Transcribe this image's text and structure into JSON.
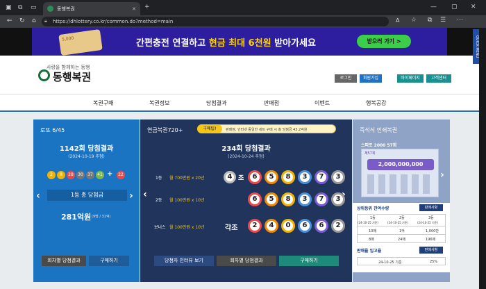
{
  "browser": {
    "tab_title": "동행복권",
    "url": "https://dhlottery.co.kr/common.do?method=main"
  },
  "banner": {
    "text_1": "간편충전 연결하고 ",
    "text_highlight": "현금 최대 6천원",
    "text_2": " 받아가세요",
    "button": "받으러 가기 >",
    "coupon_text": "5,000"
  },
  "quick_menu": "QUICK MENU",
  "header": {
    "logo_tagline": "사랑을 함께하는 동행",
    "logo_text": "동행복권",
    "buttons": [
      "로그인",
      "회원가입",
      "마이페이지",
      "고객센터"
    ],
    "nav": [
      "복권구매",
      "복권정보",
      "당첨결과",
      "판매점",
      "이벤트",
      "행복공감"
    ]
  },
  "lotto": {
    "label": "로또 6/45",
    "round_title": "1142회 당첨결과",
    "date": "(2024-10-19 추첨)",
    "balls": [
      "2",
      "8",
      "28",
      "30",
      "37",
      "41"
    ],
    "plus": "+",
    "bonus": "22",
    "first_prize_label": "1등 총 당첨금",
    "first_prize_amount": "281억원",
    "first_prize_detail": "(9명 / 31억)",
    "btn_results": "회차별 당첨결과",
    "btn_buy": "구매하기"
  },
  "pension": {
    "label": "연금복권720+",
    "badge": "구매팁!",
    "notice": "판매점, 인터넷 동일한 세트 구매 시 총 당첨금 43.2억원",
    "round_title": "234회 당첨결과",
    "date": "(2024-10-24 추첨)",
    "row1_label": "1등",
    "row1_prize": "월 700만원 x 20년",
    "row1_jo": "4",
    "row1_jo_suffix": "조",
    "row1_digits": [
      "6",
      "5",
      "8",
      "3",
      "7",
      "3"
    ],
    "row2_label": "2등",
    "row2_prize": "월 100만원 x 10년",
    "row2_digits": [
      "6",
      "5",
      "8",
      "3",
      "7",
      "3"
    ],
    "row3_label": "보너스",
    "row3_prize": "월 100만원 x 10년",
    "row3_jo": "각조",
    "row3_digits": [
      "2",
      "4",
      "0",
      "6",
      "6",
      "2"
    ],
    "btn_interview": "당첨자 인터뷰 보기",
    "btn_results": "회차별 당첨결과",
    "btn_buy": "구매하기"
  },
  "instant": {
    "label": "즉석식 인쇄복권",
    "product": "스피또 2000 57회",
    "prize": "2,000,000,000",
    "ticket_round": "제57회",
    "remain_title": "상위등위 잔여수량",
    "remain_btn": "판매사항",
    "ranks": [
      "1등",
      "2등",
      "3등"
    ],
    "rank_dates": [
      "(24-10-25 기준)",
      "(24-10-25 기준)",
      "(24-10-25 기준)"
    ],
    "row_a": [
      "10매",
      "1억",
      "1,000만"
    ],
    "row_b": [
      "8매",
      "24매",
      "196매"
    ],
    "sales_title": "판매율 입고율",
    "sales_btn": "판매사항",
    "sales_date": "24-10-25 기준",
    "sales_rate": "25%"
  }
}
